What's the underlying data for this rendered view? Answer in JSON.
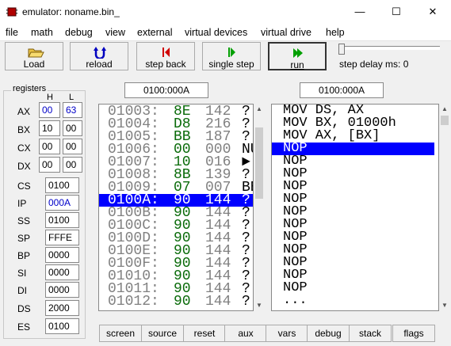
{
  "window": {
    "title": "emulator: noname.bin_",
    "minimize": "—",
    "maximize": "☐",
    "close": "✕"
  },
  "menu": [
    "file",
    "math",
    "debug",
    "view",
    "external",
    "virtual devices",
    "virtual drive",
    "help"
  ],
  "toolbar": {
    "load": "Load",
    "reload": "reload",
    "step_back": "step back",
    "single_step": "single step",
    "run": "run",
    "step_delay": "step delay ms: 0"
  },
  "address": {
    "memory": "0100:000A",
    "disassembly": "0100:000A"
  },
  "registers": {
    "title": "registers",
    "h": "H",
    "l": "L",
    "ax": {
      "label": "AX",
      "h": "00",
      "l": "63"
    },
    "bx": {
      "label": "BX",
      "h": "10",
      "l": "00"
    },
    "cx": {
      "label": "CX",
      "h": "00",
      "l": "00"
    },
    "dx": {
      "label": "DX",
      "h": "00",
      "l": "00"
    },
    "cs": {
      "label": "CS",
      "v": "0100"
    },
    "ip": {
      "label": "IP",
      "v": "000A"
    },
    "ss": {
      "label": "SS",
      "v": "0100"
    },
    "sp": {
      "label": "SP",
      "v": "FFFE"
    },
    "bp": {
      "label": "BP",
      "v": "0000"
    },
    "si": {
      "label": "SI",
      "v": "0000"
    },
    "di": {
      "label": "DI",
      "v": "0000"
    },
    "ds": {
      "label": "DS",
      "v": "2000"
    },
    "es": {
      "label": "ES",
      "v": "0100"
    }
  },
  "memory": [
    {
      "addr": "01003:",
      "hex": "8E",
      "dec": "142",
      "ch": "?"
    },
    {
      "addr": "01004:",
      "hex": "D8",
      "dec": "216",
      "ch": "?"
    },
    {
      "addr": "01005:",
      "hex": "BB",
      "dec": "187",
      "ch": "?"
    },
    {
      "addr": "01006:",
      "hex": "00",
      "dec": "000",
      "ch": "NU"
    },
    {
      "addr": "01007:",
      "hex": "10",
      "dec": "016",
      "ch": "►"
    },
    {
      "addr": "01008:",
      "hex": "8B",
      "dec": "139",
      "ch": "?"
    },
    {
      "addr": "01009:",
      "hex": "07",
      "dec": "007",
      "ch": "BE"
    },
    {
      "addr": "0100A:",
      "hex": "90",
      "dec": "144",
      "ch": "?"
    },
    {
      "addr": "0100B:",
      "hex": "90",
      "dec": "144",
      "ch": "?"
    },
    {
      "addr": "0100C:",
      "hex": "90",
      "dec": "144",
      "ch": "?"
    },
    {
      "addr": "0100D:",
      "hex": "90",
      "dec": "144",
      "ch": "?"
    },
    {
      "addr": "0100E:",
      "hex": "90",
      "dec": "144",
      "ch": "?"
    },
    {
      "addr": "0100F:",
      "hex": "90",
      "dec": "144",
      "ch": "?"
    },
    {
      "addr": "01010:",
      "hex": "90",
      "dec": "144",
      "ch": "?"
    },
    {
      "addr": "01011:",
      "hex": "90",
      "dec": "144",
      "ch": "?"
    },
    {
      "addr": "01012:",
      "hex": "90",
      "dec": "144",
      "ch": "?"
    }
  ],
  "disassembly": [
    "MOV DS, AX",
    "MOV BX, 01000h",
    "MOV AX, [BX]",
    "NOP",
    "NOP",
    "NOP",
    "NOP",
    "NOP",
    "NOP",
    "NOP",
    "NOP",
    "NOP",
    "NOP",
    "NOP",
    "NOP",
    "..."
  ],
  "bottom": [
    "screen",
    "source",
    "reset",
    "aux",
    "vars",
    "debug",
    "stack",
    "flags"
  ]
}
